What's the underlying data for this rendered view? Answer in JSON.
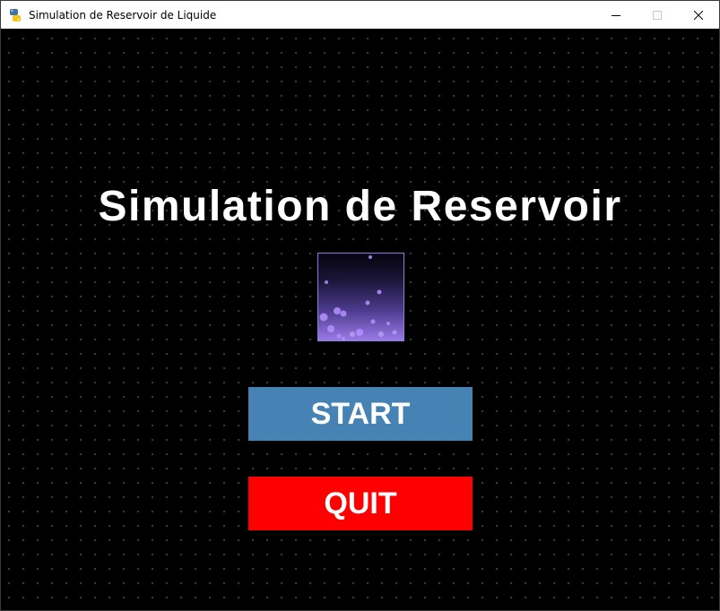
{
  "window": {
    "title": "Simulation de Reservoir de Liquide",
    "app_icon": "python-icon",
    "controls": [
      "minimize-icon",
      "maximize-icon",
      "close-icon"
    ]
  },
  "game": {
    "title": "Simulation de Reservoir",
    "preview": "reservoir-liquid-image",
    "buttons": {
      "start_label": "START",
      "quit_label": "QUIT"
    }
  },
  "colors": {
    "background": "#000000",
    "grid_dots": "#3b3b3b",
    "title_text": "#ffffff",
    "start_button": "#4682b4",
    "quit_button": "#ff0000",
    "liquid": "#9a7ae8"
  }
}
